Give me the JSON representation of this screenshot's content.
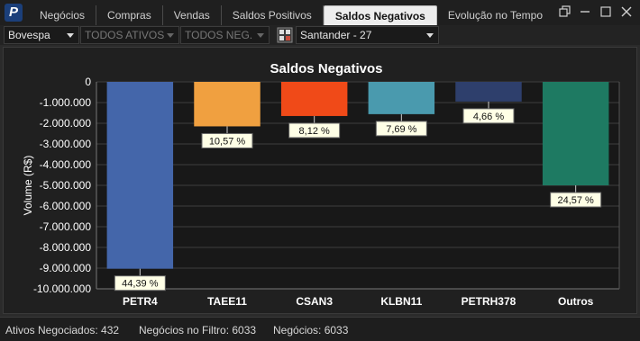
{
  "app": {
    "logo_letter": "P"
  },
  "tabs": [
    {
      "label": "Negócios",
      "active": false
    },
    {
      "label": "Compras",
      "active": false
    },
    {
      "label": "Vendas",
      "active": false
    },
    {
      "label": "Saldos Positivos",
      "active": false
    },
    {
      "label": "Saldos Negativos",
      "active": true
    },
    {
      "label": "Evolução no Tempo",
      "active": false
    }
  ],
  "toolbar": {
    "exchange": "Bovespa",
    "assets": "TODOS ATIVOS",
    "trades": "TODOS NEG.",
    "broker": "Santander - 27"
  },
  "status": {
    "ativos_negociados": "Ativos Negociados: 432",
    "negocios_filtro": "Negócios no Filtro: 6033",
    "negocios": "Negócios: 6033"
  },
  "colors": {
    "PETR4": "#4466aa",
    "TAEE11": "#f0a040",
    "CSAN3": "#f04a18",
    "KLBN11": "#4a9aae",
    "PETRH378": "#2e3f6c",
    "Outros": "#1e7a62"
  },
  "chart_data": {
    "type": "bar",
    "title": "Saldos Negativos",
    "xlabel": "",
    "ylabel": "Volume (R$)",
    "ylim": [
      -10000000,
      0
    ],
    "yticks": [
      "0",
      "-1.000.000",
      "-2.000.000",
      "-3.000.000",
      "-4.000.000",
      "-5.000.000",
      "-6.000.000",
      "-7.000.000",
      "-8.000.000",
      "-9.000.000",
      "-10.000.000"
    ],
    "categories": [
      "PETR4",
      "TAEE11",
      "CSAN3",
      "KLBN11",
      "PETRH378",
      "Outros"
    ],
    "values": [
      -9030000,
      -2150000,
      -1650000,
      -1560000,
      -950000,
      -5000000
    ],
    "labels": [
      "44,39 %",
      "10,57 %",
      "8,12 %",
      "7,69 %",
      "4,66 %",
      "24,57 %"
    ],
    "grid": true,
    "legend": "none"
  }
}
